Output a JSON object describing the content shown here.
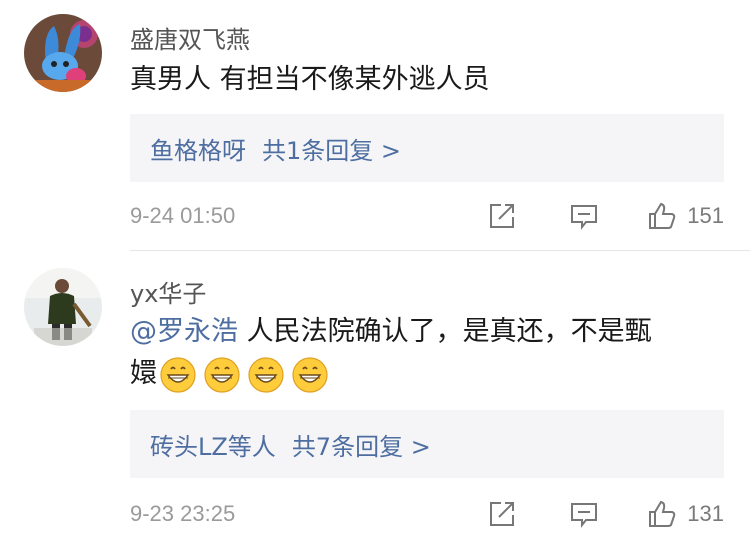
{
  "comments": [
    {
      "username": "盛唐双飞燕",
      "text": "真男人 有担当不像某外逃人员",
      "replies": {
        "names": "鱼格格呀",
        "summary": "共1条回复 >"
      },
      "timestamp": "9-24 01:50",
      "likes": "151",
      "avatar_icon": "cartoon-rabbit-icon"
    },
    {
      "username": "yx华子",
      "mention": "@罗永浩",
      "text_line1": " 人民法院确认了，是真还，不是甄",
      "text_line2": "嬛",
      "emoji_icon": "grinning-face-icon",
      "emoji_count": 4,
      "replies": {
        "names": "砖头LZ等人",
        "summary": "共7条回复 >"
      },
      "timestamp": "9-23 23:25",
      "likes": "131",
      "avatar_icon": "person-with-bat-icon"
    }
  ],
  "colors": {
    "link": "#4e6ea1",
    "username": "#555555",
    "text": "#1a1a1a",
    "meta": "#9a9a9a",
    "reply_bg": "#f5f5f7"
  }
}
